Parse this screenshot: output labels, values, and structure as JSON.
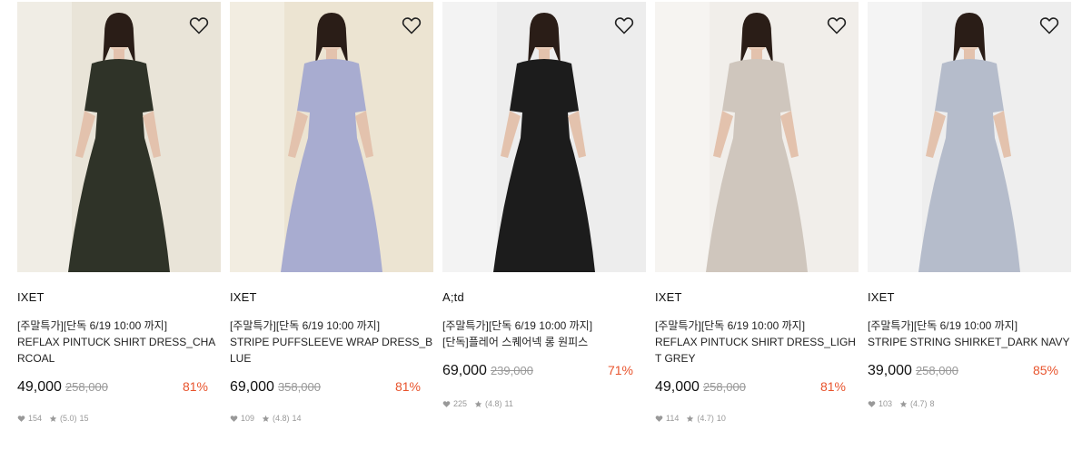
{
  "products": [
    {
      "brand": "IXET",
      "promo": "[주말특가][단독 6/19 10:00 까지]",
      "name": "REFLAX PINTUCK SHIRT DRESS_CHARCOAL",
      "price": "49,000",
      "original_price": "258,000",
      "discount": "81%",
      "likes": "154",
      "rating": "(5.0)",
      "reviews": "15",
      "colors": {
        "bg": "#e9e4d8",
        "garment": "#2f3328"
      }
    },
    {
      "brand": "IXET",
      "promo": "[주말특가][단독 6/19 10:00 까지]",
      "name": "STRIPE PUFFSLEEVE WRAP DRESS_BLUE",
      "price": "69,000",
      "original_price": "358,000",
      "discount": "81%",
      "likes": "109",
      "rating": "(4.8)",
      "reviews": "14",
      "colors": {
        "bg": "#ece4d2",
        "garment": "#a8acd0"
      }
    },
    {
      "brand": "A;td",
      "promo": "[주말특가][단독 6/19 10:00 까지]",
      "name": "[단독]플레어 스퀘어넥 롱 원피스",
      "price": "69,000",
      "original_price": "239,000",
      "discount": "71%",
      "likes": "225",
      "rating": "(4.8)",
      "reviews": "11",
      "colors": {
        "bg": "#ededed",
        "garment": "#1c1c1c"
      }
    },
    {
      "brand": "IXET",
      "promo": "[주말특가][단독 6/19 10:00 까지]",
      "name": "REFLAX PINTUCK SHIRT DRESS_LIGHT GREY",
      "price": "49,000",
      "original_price": "258,000",
      "discount": "81%",
      "likes": "114",
      "rating": "(4.7)",
      "reviews": "10",
      "colors": {
        "bg": "#f1eeea",
        "garment": "#cfc6bd"
      }
    },
    {
      "brand": "IXET",
      "promo": "[주말특가][단독 6/19 10:00 까지]",
      "name": "STRIPE STRING SHIRKET_DARK NAVY",
      "price": "39,000",
      "original_price": "258,000",
      "discount": "85%",
      "likes": "103",
      "rating": "(4.7)",
      "reviews": "8",
      "colors": {
        "bg": "#eeeeee",
        "garment": "#b5bccb"
      }
    }
  ],
  "icons": {
    "wishlist": "heart-outline-icon",
    "likes": "heart-icon",
    "rating": "star-icon"
  },
  "accent": "#e8542d"
}
